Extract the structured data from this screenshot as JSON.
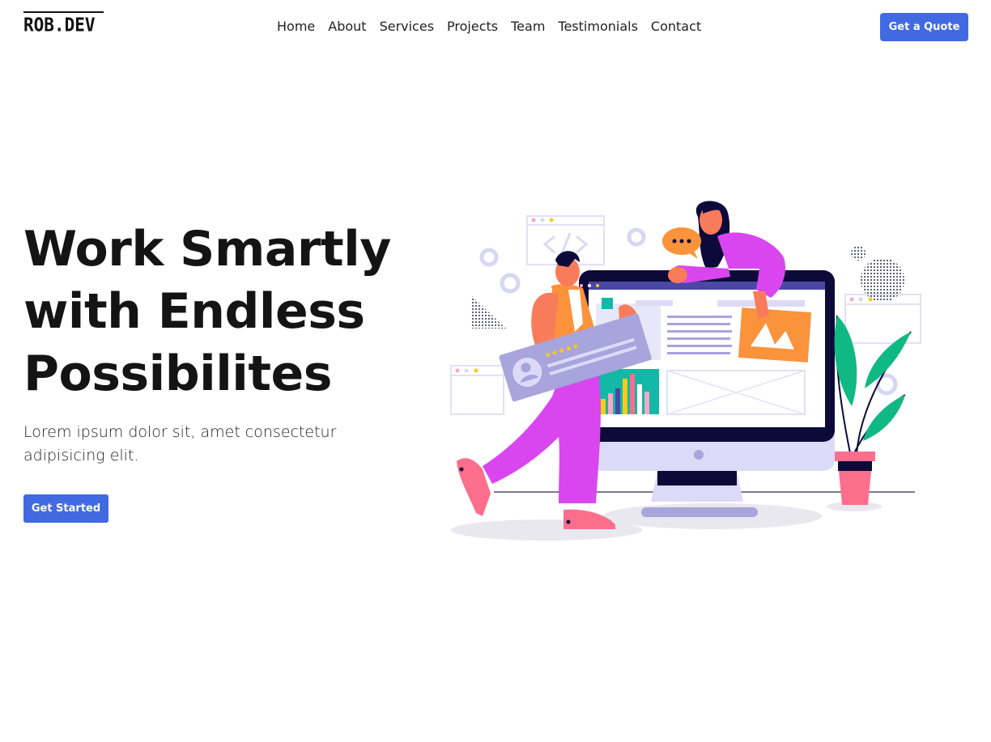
{
  "brand": {
    "logo_text": "ROB.DEV"
  },
  "nav": {
    "items": [
      {
        "label": "Home"
      },
      {
        "label": "About"
      },
      {
        "label": "Services"
      },
      {
        "label": "Projects"
      },
      {
        "label": "Team"
      },
      {
        "label": "Testimonials"
      },
      {
        "label": "Contact"
      }
    ],
    "cta_label": "Get a Quote"
  },
  "hero": {
    "title_lines": [
      "Work Smartly",
      "with Endless",
      "Possibilites"
    ],
    "subtitle": "Lorem ipsum dolor sit, amet consectetur adipisicing elit.",
    "cta_label": "Get Started"
  },
  "colors": {
    "accent": "#4169e1",
    "text": "#141414",
    "monitor_frame": "#0d0a3a",
    "screen_lavender": "#dcdaf7",
    "person_pink": "#d946ef",
    "person_orange": "#f97316",
    "plant_green": "#10b981",
    "pot_pink": "#fb6f8c",
    "chart_teal": "#14b8a6"
  },
  "illustration": {
    "icon": "developer-team-illustration"
  }
}
